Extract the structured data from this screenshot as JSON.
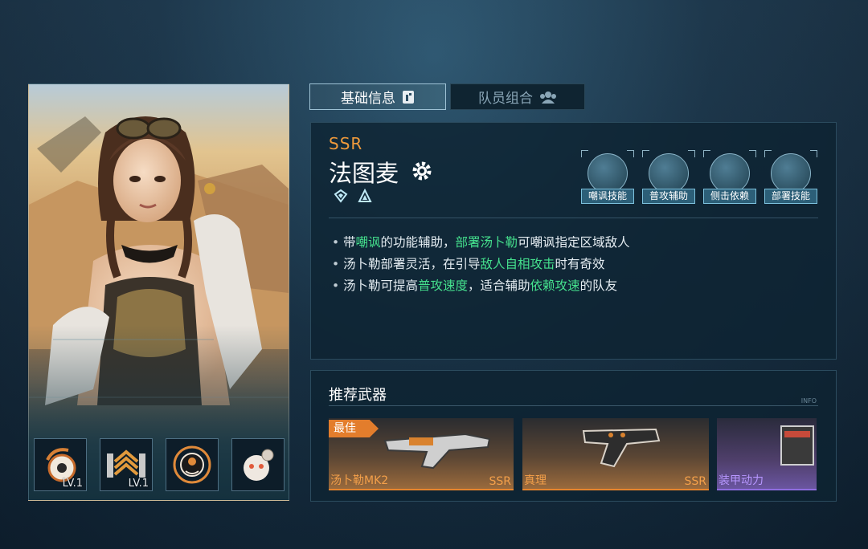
{
  "tabs": [
    {
      "label": "基础信息",
      "active": true,
      "icon": "info-card-icon"
    },
    {
      "label": "队员组合",
      "active": false,
      "icon": "team-icon"
    }
  ],
  "character": {
    "rarity": "SSR",
    "name": "法图麦",
    "class_icon": "gear-icon",
    "element_icons": [
      "diamond-crest-icon",
      "triangle-crest-icon"
    ]
  },
  "skills": [
    {
      "label": "嘲讽技能",
      "icon": "taunt-icon"
    },
    {
      "label": "普攻辅助",
      "icon": "attack-support-icon"
    },
    {
      "label": "侧击依赖",
      "icon": "flank-icon"
    },
    {
      "label": "部署技能",
      "icon": "deploy-drone-icon"
    }
  ],
  "description": [
    [
      {
        "t": "带"
      },
      {
        "t": "嘲讽",
        "hl": true
      },
      {
        "t": "的功能辅助，"
      },
      {
        "t": "部署汤卜勒",
        "hl": true
      },
      {
        "t": "可嘲讽指定区域敌人"
      }
    ],
    [
      {
        "t": "汤卜勒部署灵活，在引导"
      },
      {
        "t": "敌人自相攻击",
        "hl": true
      },
      {
        "t": "时有奇效"
      }
    ],
    [
      {
        "t": "汤卜勒可提高"
      },
      {
        "t": "普攻速度",
        "hl": true
      },
      {
        "t": "，适合辅助"
      },
      {
        "t": "依赖攻速",
        "hl": true
      },
      {
        "t": "的队友"
      }
    ]
  ],
  "badges": [
    {
      "icon": "bomb-emblem-icon",
      "level": "LV.1"
    },
    {
      "icon": "soldier-rank-icon",
      "level": "LV.1"
    },
    {
      "icon": "target-emblem-icon",
      "level": ""
    },
    {
      "icon": "robot-pet-icon",
      "level": ""
    }
  ],
  "weapons": {
    "title": "推荐武器",
    "info_label": "INFO",
    "best_label": "最佳",
    "items": [
      {
        "name": "汤卜勒MK2",
        "rarity": "SSR",
        "tier": "orange",
        "best": true
      },
      {
        "name": "真理",
        "rarity": "SSR",
        "tier": "orange",
        "best": false
      },
      {
        "name": "装甲动力",
        "rarity": "",
        "tier": "purple",
        "best": false
      }
    ]
  },
  "colors": {
    "accent_orange": "#ef9a3b",
    "highlight_green": "#45e08d",
    "tab_active_border": "#9fc3d6",
    "purple_tier": "#8f6de0"
  }
}
